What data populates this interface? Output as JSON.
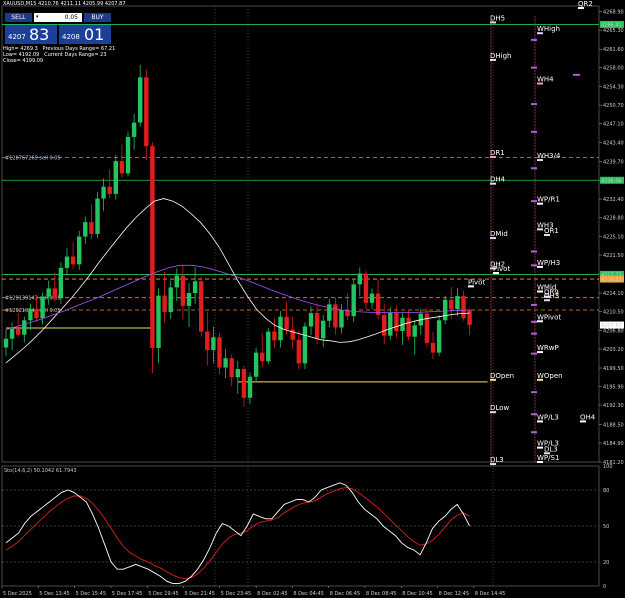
{
  "header": {
    "symbol": "XAUUSD,M15",
    "ohlc": "4210.76 4211.11 4205.99 4207.87"
  },
  "trade_panel": {
    "sell_label": "SELL",
    "buy_label": "BUY",
    "lot": "0.05",
    "sell_small": "4207",
    "sell_big": "83",
    "buy_small": "4208",
    "buy_big": "01"
  },
  "stats": {
    "high": "High= 4269.3",
    "low": "Low= 4192.09",
    "close": "Close= 4199.09",
    "prev_range": "Previous Days Range= 67.21",
    "cur_range": "Current Days Range= 23"
  },
  "colors": {
    "background": "#000000",
    "bull": "#22c55e",
    "bear": "#e11d1d",
    "ma_white": "#ffffff",
    "ma_purple": "#a855f7",
    "green_line": "#22c55e",
    "orange_dash": "#f4a340",
    "yellow_line": "#f1e15b",
    "stoch_main": "#ffffff",
    "stoch_signal": "#e11d1d"
  },
  "chart_data": [
    {
      "type": "candlestick",
      "symbol": "XAUUSD",
      "timeframe": "M15",
      "ylim": [
        4181.2,
        4270.0
      ],
      "y_ticks": [
        "4268.90",
        "4265.30",
        "4261.60",
        "4258.00",
        "4254.30",
        "4250.70",
        "4247.10",
        "4243.40",
        "4239.70",
        "4236.10",
        "4232.40",
        "4228.80",
        "4225.10",
        "4221.50",
        "4217.90",
        "4214.10",
        "4210.50",
        "4206.80",
        "4203.20",
        "4199.50",
        "4195.90",
        "4192.30",
        "4188.50",
        "4184.90",
        "4181.20"
      ],
      "x_ticks": [
        "5 Dec 2025",
        "5 Dec 13:45",
        "5 Dec 15:45",
        "5 Dec 17:45",
        "5 Dec 19:45",
        "5 Dec 21:45",
        "5 Dec 23:45",
        "8 Dec 02:45",
        "8 Dec 04:45",
        "8 Dec 06:45",
        "8 Dec 08:45",
        "8 Dec 10:45",
        "8 Dec 12:45",
        "8 Dec 14:45"
      ],
      "price_boxes": [
        {
          "label": "4266.41",
          "y": 4266.41,
          "color": "#22c55e"
        },
        {
          "label": "4236.06",
          "y": 4236.06,
          "color": "#22c55e"
        },
        {
          "label": "4217.73",
          "y": 4217.73,
          "color": "#22c55e"
        },
        {
          "label": "4216.82",
          "y": 4216.82,
          "color": "#f4a340"
        },
        {
          "label": "4207.87",
          "y": 4207.87,
          "color": "#ffffff"
        }
      ],
      "horizontal_lines": [
        {
          "name": "green-1",
          "y": 4266.41,
          "style": "solid",
          "color": "#22c55e"
        },
        {
          "name": "green-2",
          "y": 4236.06,
          "style": "solid",
          "color": "#22c55e"
        },
        {
          "name": "green-3",
          "y": 4217.73,
          "style": "solid",
          "color": "#22c55e"
        },
        {
          "name": "orange-dash-1",
          "y": 4240.5,
          "style": "dashed",
          "color": "#e0883a"
        },
        {
          "name": "orange-dash-2",
          "y": 4216.82,
          "style": "dashed",
          "color": "#f4a340"
        },
        {
          "name": "orange-dash-3",
          "y": 4213.2,
          "style": "dashed",
          "color": "#e0883a"
        },
        {
          "name": "orange-dash-4",
          "y": 4210.8,
          "style": "dashed",
          "color": "#e0883a"
        }
      ],
      "order_labels": [
        {
          "text": "#128767269 sell 0.05",
          "y": 4240.5
        },
        {
          "text": "#129139143 sell 0.05",
          "y": 4213.2
        },
        {
          "text": "#129210344 sell 0.05",
          "y": 4210.8
        }
      ],
      "pivot_labels": [
        {
          "text": "DH5",
          "y": 4266.8,
          "color": "#e9d5ff",
          "col": "d"
        },
        {
          "text": "DHigh",
          "y": 4259.5,
          "color": "#e9d5ff",
          "col": "d"
        },
        {
          "text": "DR1",
          "y": 4240.6,
          "color": "#ff9aa8",
          "col": "d"
        },
        {
          "text": "DH4",
          "y": 4235.4,
          "color": "#e9d5ff",
          "col": "d"
        },
        {
          "text": "DMid",
          "y": 4224.8,
          "color": "#e9d5ff",
          "col": "d"
        },
        {
          "text": "DH2",
          "y": 4218.9,
          "color": "#e9d5ff",
          "col": "d"
        },
        {
          "text": "Pivot",
          "y": 4218.0,
          "color": "#ffffff",
          "col": "d2"
        },
        {
          "text": "Pivot",
          "y": 4215.4,
          "color": "#ffffff",
          "col": "p"
        },
        {
          "text": "DOpen",
          "y": 4197.2,
          "color": "#ffe08a",
          "col": "d"
        },
        {
          "text": "DLow",
          "y": 4190.9,
          "color": "#e9d5ff",
          "col": "d"
        },
        {
          "text": "DL3",
          "y": 4180.8,
          "color": "#e9d5ff",
          "col": "d"
        },
        {
          "text": "WHigh",
          "y": 4264.7,
          "color": "#e9d5ff",
          "col": "w"
        },
        {
          "text": "WH4",
          "y": 4254.9,
          "color": "#ff9aa8",
          "col": "w"
        },
        {
          "text": "WH3/4",
          "y": 4240.0,
          "color": "#e9d5ff",
          "col": "w"
        },
        {
          "text": "WP/R1",
          "y": 4231.5,
          "color": "#ffffff",
          "col": "w"
        },
        {
          "text": "WH3",
          "y": 4226.5,
          "color": "#e9d5ff",
          "col": "w"
        },
        {
          "text": "OR1",
          "y": 4225.4,
          "color": "#e9d5ff",
          "col": "w2"
        },
        {
          "text": "WP/H3",
          "y": 4219.2,
          "color": "#ffffff",
          "col": "w"
        },
        {
          "text": "WMid",
          "y": 4214.4,
          "color": "#ffffff",
          "col": "w"
        },
        {
          "text": "OR9",
          "y": 4213.4,
          "color": "#e9d5ff",
          "col": "w2"
        },
        {
          "text": "OH3",
          "y": 4212.7,
          "color": "#e9d5ff",
          "col": "w2"
        },
        {
          "text": "WPivot",
          "y": 4208.6,
          "color": "#ffffff",
          "col": "w"
        },
        {
          "text": "WRwP",
          "y": 4202.6,
          "color": "#ffffff",
          "col": "w"
        },
        {
          "text": "WOpen",
          "y": 4197.2,
          "color": "#ffe08a",
          "col": "w"
        },
        {
          "text": "WP/L3",
          "y": 4189.1,
          "color": "#ffffff",
          "col": "w"
        },
        {
          "text": "OH4",
          "y": 4189.1,
          "color": "#ffffff",
          "col": "w3"
        },
        {
          "text": "WP/L3",
          "y": 4184.0,
          "color": "#ffffff",
          "col": "w"
        },
        {
          "text": "DL3",
          "y": 4182.9,
          "color": "#e9d5ff",
          "col": "w2"
        },
        {
          "text": "WP/S1",
          "y": 4181.2,
          "color": "#ffffff",
          "col": "w"
        },
        {
          "text": "QR2",
          "y": 4269.6,
          "color": "#ffffff",
          "col": "q"
        }
      ],
      "candles": [
        [
          4203.5,
          4207.0,
          4201.8,
          4205.2
        ],
        [
          4205.2,
          4208.4,
          4203.0,
          4207.1
        ],
        [
          4207.1,
          4210.2,
          4205.5,
          4206.0
        ],
        [
          4206.0,
          4209.5,
          4204.5,
          4208.8
        ],
        [
          4208.8,
          4212.0,
          4206.9,
          4211.0
        ],
        [
          4211.0,
          4213.5,
          4208.5,
          4209.2
        ],
        [
          4209.2,
          4214.2,
          4208.0,
          4213.4
        ],
        [
          4213.4,
          4216.5,
          4211.8,
          4215.0
        ],
        [
          4215.0,
          4218.0,
          4212.4,
          4213.1
        ],
        [
          4213.1,
          4220.1,
          4212.0,
          4219.0
        ],
        [
          4219.0,
          4222.8,
          4217.5,
          4221.2
        ],
        [
          4221.2,
          4224.0,
          4218.8,
          4219.7
        ],
        [
          4219.7,
          4226.2,
          4218.6,
          4225.1
        ],
        [
          4225.1,
          4229.0,
          4223.7,
          4227.9
        ],
        [
          4227.9,
          4231.4,
          4224.6,
          4225.6
        ],
        [
          4225.6,
          4233.8,
          4224.8,
          4232.5
        ],
        [
          4232.5,
          4236.4,
          4230.1,
          4234.8
        ],
        [
          4234.8,
          4238.2,
          4232.6,
          4233.4
        ],
        [
          4233.4,
          4241.0,
          4232.3,
          4239.8
        ],
        [
          4239.8,
          4243.0,
          4236.5,
          4237.4
        ],
        [
          4237.4,
          4245.5,
          4236.8,
          4244.5
        ],
        [
          4244.5,
          4249.0,
          4242.0,
          4247.3
        ],
        [
          4247.3,
          4258.5,
          4246.5,
          4256.1
        ],
        [
          4256.1,
          4257.6,
          4240.0,
          4242.7
        ],
        [
          4242.7,
          4243.5,
          4198.5,
          4203.4
        ],
        [
          4203.4,
          4215.0,
          4200.5,
          4213.6
        ],
        [
          4213.6,
          4218.2,
          4208.3,
          4210.4
        ],
        [
          4210.4,
          4216.5,
          4209.1,
          4215.2
        ],
        [
          4215.2,
          4218.9,
          4212.5,
          4217.5
        ],
        [
          4217.5,
          4219.6,
          4209.0,
          4211.6
        ],
        [
          4211.6,
          4216.0,
          4207.5,
          4214.1
        ],
        [
          4214.1,
          4219.1,
          4212.0,
          4216.4
        ],
        [
          4216.4,
          4217.3,
          4205.6,
          4206.6
        ],
        [
          4206.6,
          4210.5,
          4200.0,
          4203.0
        ],
        [
          4203.0,
          4207.6,
          4200.5,
          4205.5
        ],
        [
          4205.5,
          4206.4,
          4198.3,
          4199.6
        ],
        [
          4199.6,
          4203.2,
          4197.5,
          4201.4
        ],
        [
          4201.4,
          4202.1,
          4196.0,
          4197.7
        ],
        [
          4197.7,
          4200.9,
          4194.5,
          4199.3
        ],
        [
          4199.3,
          4199.9,
          4192.0,
          4193.7
        ],
        [
          4193.7,
          4198.6,
          4192.5,
          4197.8
        ],
        [
          4197.8,
          4203.5,
          4197.0,
          4202.5
        ],
        [
          4202.5,
          4206.3,
          4199.6,
          4200.8
        ],
        [
          4200.8,
          4207.3,
          4200.3,
          4206.6
        ],
        [
          4206.6,
          4209.2,
          4203.4,
          4204.9
        ],
        [
          4204.9,
          4210.6,
          4203.5,
          4209.5
        ],
        [
          4209.5,
          4212.4,
          4206.0,
          4207.0
        ],
        [
          4207.0,
          4209.5,
          4203.2,
          4205.0
        ],
        [
          4205.0,
          4206.8,
          4199.2,
          4200.4
        ],
        [
          4200.4,
          4208.4,
          4199.3,
          4207.6
        ],
        [
          4207.6,
          4211.5,
          4205.9,
          4210.2
        ],
        [
          4210.2,
          4211.8,
          4204.2,
          4205.3
        ],
        [
          4205.3,
          4209.8,
          4203.6,
          4208.7
        ],
        [
          4208.7,
          4213.0,
          4207.4,
          4211.9
        ],
        [
          4211.9,
          4213.2,
          4206.0,
          4207.4
        ],
        [
          4207.4,
          4212.0,
          4206.2,
          4210.7
        ],
        [
          4210.7,
          4214.0,
          4208.8,
          4209.6
        ],
        [
          4209.6,
          4216.7,
          4208.5,
          4215.8
        ],
        [
          4215.8,
          4219.1,
          4213.5,
          4217.9
        ],
        [
          4217.9,
          4218.5,
          4211.0,
          4212.2
        ],
        [
          4212.2,
          4215.0,
          4211.0,
          4214.0
        ],
        [
          4214.0,
          4216.8,
          4209.0,
          4209.8
        ],
        [
          4209.8,
          4212.0,
          4204.2,
          4205.8
        ],
        [
          4205.8,
          4211.4,
          4205.0,
          4210.3
        ],
        [
          4210.3,
          4211.6,
          4205.4,
          4206.7
        ],
        [
          4206.7,
          4210.3,
          4204.0,
          4209.3
        ],
        [
          4209.3,
          4210.9,
          4204.9,
          4205.6
        ],
        [
          4205.6,
          4208.7,
          4202.1,
          4207.8
        ],
        [
          4207.8,
          4211.0,
          4206.0,
          4210.1
        ],
        [
          4210.1,
          4211.3,
          4203.5,
          4204.4
        ],
        [
          4204.4,
          4206.5,
          4201.2,
          4202.5
        ],
        [
          4202.5,
          4209.8,
          4201.9,
          4208.8
        ],
        [
          4208.8,
          4213.6,
          4208.0,
          4212.8
        ],
        [
          4212.8,
          4215.3,
          4209.0,
          4211.0
        ],
        [
          4211.0,
          4215.1,
          4209.6,
          4213.5
        ],
        [
          4213.5,
          4214.5,
          4208.7,
          4209.2
        ],
        [
          4210.8,
          4211.1,
          4205.9,
          4207.9
        ]
      ],
      "ma_white": [
        4200.5,
        4202.0,
        4203.5,
        4205.2,
        4207.0,
        4209.0,
        4211.0,
        4213.0,
        4215.2,
        4217.5,
        4220.0,
        4222.3,
        4224.6,
        4226.8,
        4228.8,
        4230.5,
        4232.0,
        4232.5,
        4232.0,
        4231.0,
        4229.5,
        4227.8,
        4225.6,
        4223.0,
        4219.8,
        4216.5,
        4213.6,
        4211.0,
        4209.2,
        4207.8,
        4207.0,
        4206.5,
        4206.0,
        4205.5,
        4205.0,
        4204.8,
        4204.5,
        4204.6,
        4205.0,
        4205.6,
        4206.2,
        4206.9,
        4207.5,
        4208.1,
        4208.6,
        4209.0,
        4209.3,
        4209.6,
        4209.9,
        4210.1,
        4210.2
      ],
      "ma_purple": [
        4207.0,
        4207.6,
        4208.3,
        4209.0,
        4209.8,
        4210.6,
        4211.5,
        4212.4,
        4213.3,
        4214.3,
        4215.3,
        4216.3,
        4217.3,
        4218.2,
        4219.0,
        4219.5,
        4219.5,
        4219.2,
        4218.6,
        4217.9,
        4217.2,
        4216.4,
        4215.5,
        4214.6,
        4213.8,
        4213.0,
        4212.3,
        4211.7,
        4211.2,
        4210.8,
        4210.5,
        4210.4,
        4210.3,
        4210.3,
        4210.3,
        4210.3,
        4210.4,
        4210.5,
        4210.6,
        4210.7,
        4210.8
      ],
      "yellow_segments": [
        {
          "from_index": 0,
          "to_index": 24,
          "y": 4207.3
        },
        {
          "from_index": 38,
          "to_index": 76,
          "y": 4196.8
        }
      ]
    },
    {
      "type": "line",
      "title": "Sto(14,6,2) 50.1042 61.7943",
      "ylim": [
        0,
        100
      ],
      "y_ticks": [
        "100",
        "80",
        "50",
        "20",
        "0"
      ],
      "levels": [
        80,
        50,
        20
      ],
      "series": [
        {
          "values": [
            36,
            40,
            44,
            52,
            58,
            62,
            66,
            70,
            74,
            78,
            80,
            78,
            74,
            70,
            60,
            48,
            34,
            20,
            14,
            14,
            16,
            18,
            16,
            14,
            11,
            8,
            4,
            2,
            2,
            4,
            8,
            14,
            22,
            32,
            44,
            52,
            50,
            46,
            42,
            50,
            60,
            58,
            56,
            56,
            62,
            68,
            70,
            72,
            72,
            70,
            74,
            80,
            82,
            84,
            86,
            84,
            78,
            70,
            64,
            60,
            56,
            50,
            46,
            42,
            36,
            32,
            30,
            26,
            36,
            48,
            54,
            58,
            64,
            68,
            60,
            50
          ]
        },
        {
          "values": [
            30,
            33,
            37,
            42,
            47,
            52,
            57,
            62,
            66,
            70,
            73,
            75,
            75,
            73,
            69,
            63,
            56,
            48,
            40,
            33,
            28,
            25,
            22,
            20,
            17,
            15,
            12,
            9,
            7,
            6,
            7,
            10,
            15,
            21,
            28,
            35,
            40,
            43,
            44,
            46,
            50,
            53,
            54,
            55,
            57,
            61,
            64,
            67,
            69,
            70,
            71,
            74,
            77,
            79,
            81,
            82,
            81,
            78,
            74,
            70,
            66,
            61,
            56,
            51,
            46,
            41,
            37,
            34,
            35,
            38,
            43,
            49,
            55,
            59,
            61,
            58
          ]
        }
      ]
    }
  ]
}
